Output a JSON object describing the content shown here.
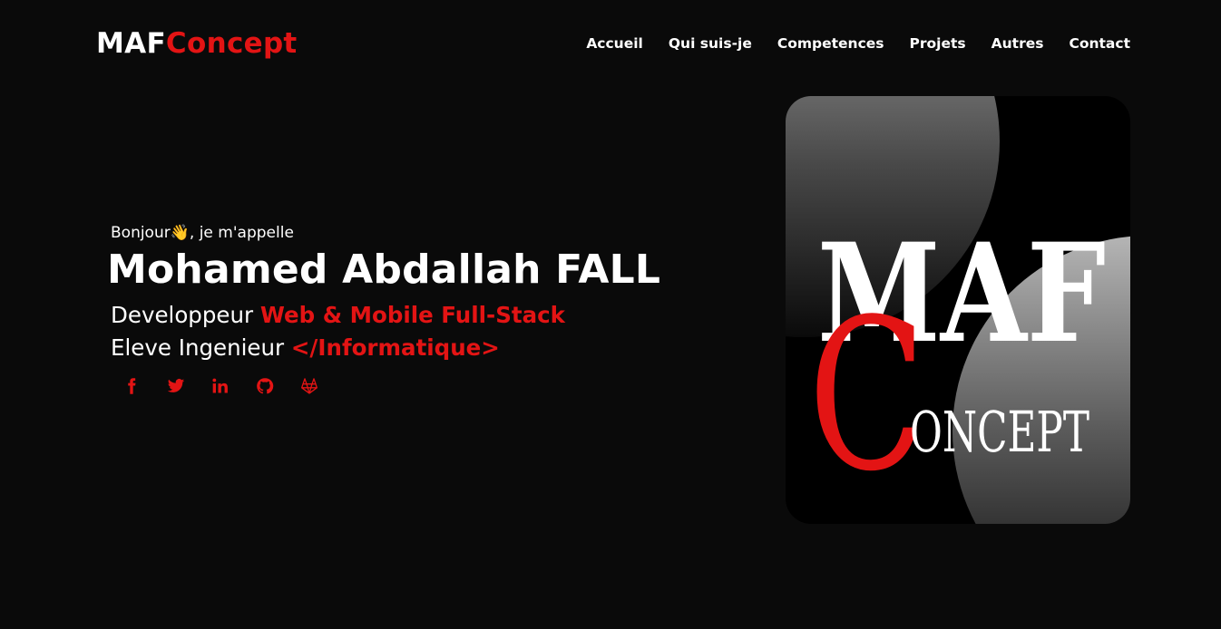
{
  "brand": {
    "part1": "MAF",
    "part2": "Concept"
  },
  "nav": {
    "items": [
      "Accueil",
      "Qui suis-je",
      "Competences",
      "Projets",
      "Autres",
      "Contact"
    ]
  },
  "hero": {
    "greeting_prefix": "Bonjour",
    "greeting_emoji": "👋",
    "greeting_suffix": ", je m'appelle",
    "name": "Mohamed Abdallah FALL",
    "role1_prefix": "Developpeur ",
    "role1_highlight": "Web & Mobile Full-Stack",
    "role2_prefix": "Eleve Ingenieur ",
    "role2_highlight": "</Informatique>"
  },
  "socials": [
    {
      "icon": "facebook-icon"
    },
    {
      "icon": "twitter-icon"
    },
    {
      "icon": "linkedin-icon"
    },
    {
      "icon": "github-icon"
    },
    {
      "icon": "gitlab-icon"
    }
  ],
  "hero_image": {
    "logo_top": "MAF",
    "logo_letter": "C",
    "logo_rest": "ONCEPT"
  },
  "colors": {
    "accent": "#e31414",
    "background": "#0a0a0a",
    "text": "#ffffff"
  }
}
